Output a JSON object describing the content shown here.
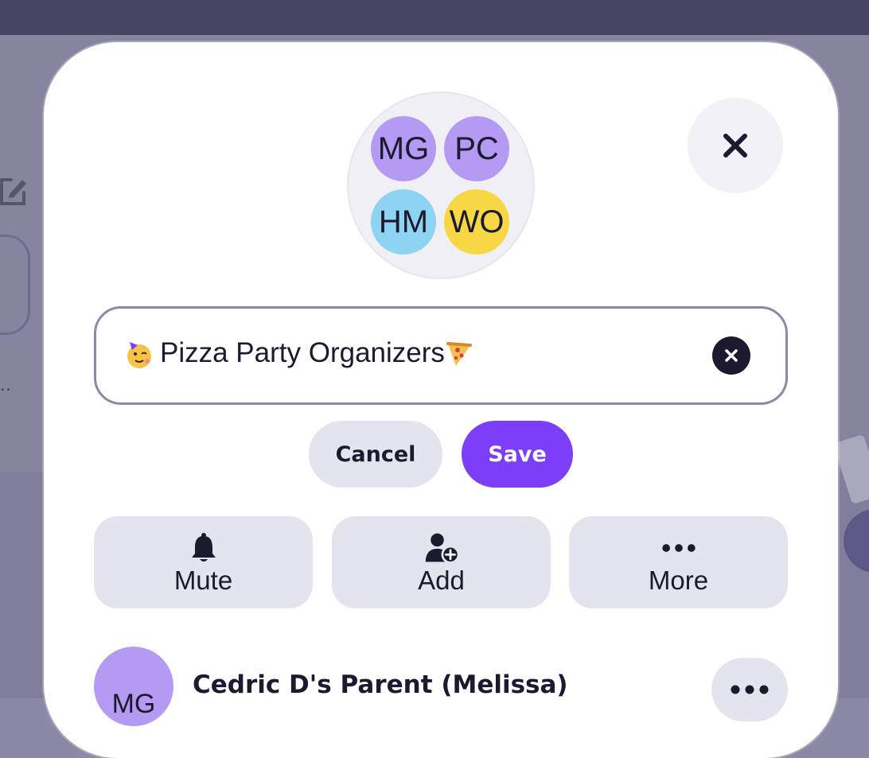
{
  "group": {
    "avatar_initials": [
      "MG",
      "PC",
      "HM",
      "WO"
    ],
    "avatar_colors": [
      "#b59af4",
      "#b59af4",
      "#8dd4f2",
      "#f7d844"
    ]
  },
  "name_field": {
    "value": "Pizza Party Organizers",
    "leading_emoji": "partying-face",
    "trailing_emoji": "pizza"
  },
  "buttons": {
    "cancel": "Cancel",
    "save": "Save"
  },
  "actions": [
    {
      "label": "Mute",
      "icon": "bell-icon"
    },
    {
      "label": "Add",
      "icon": "add-person-icon"
    },
    {
      "label": "More",
      "icon": "more-horizontal-icon"
    }
  ],
  "members": [
    {
      "initials": "MG",
      "name": "Cedric D's Parent (Melissa)",
      "color": "#b59af4"
    }
  ],
  "colors": {
    "accent": "#7c3ef6",
    "pill_bg": "#e4e4ee",
    "text": "#1b1a2e"
  }
}
